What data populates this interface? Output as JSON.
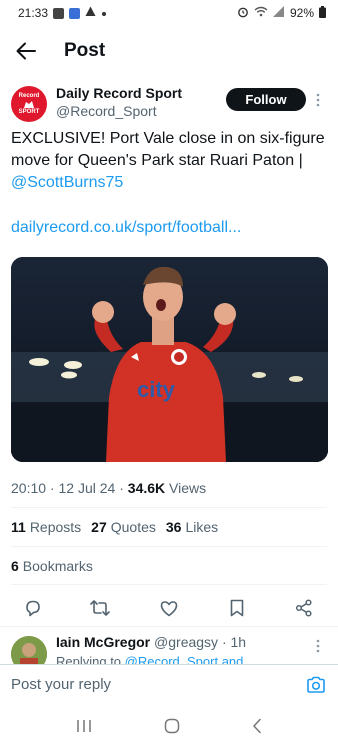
{
  "status_bar": {
    "time": "21:33",
    "battery": "92%"
  },
  "header": {
    "title": "Post"
  },
  "author": {
    "name": "Daily Record Sport",
    "handle": "@Record_Sport",
    "avatar_line1": "Record",
    "avatar_line2": "SPORT",
    "follow_label": "Follow"
  },
  "tweet": {
    "text": "EXCLUSIVE! Port Vale close in on six-figure move for Queen's Park star Ruari Paton | ",
    "mention": "@ScottBurns75",
    "link": "dailyrecord.co.uk/sport/football..."
  },
  "meta": {
    "time": "20:10",
    "date": "12 Jul 24",
    "views_count": "34.6K",
    "views_label": "Views"
  },
  "stats": {
    "reposts_count": "11",
    "reposts_label": "Reposts",
    "quotes_count": "27",
    "quotes_label": "Quotes",
    "likes_count": "36",
    "likes_label": "Likes",
    "bookmarks_count": "6",
    "bookmarks_label": "Bookmarks"
  },
  "reply": {
    "name": "Iain McGregor",
    "handle": "@greagsy",
    "age": "1h",
    "replying_prefix": "Replying to",
    "replying_to": "@Record_Sport and"
  },
  "compose": {
    "placeholder": "Post your reply"
  },
  "colors": {
    "accent": "#1d9bf0",
    "text": "#0f1419",
    "muted": "#536471",
    "brand_red": "#e0182d"
  }
}
